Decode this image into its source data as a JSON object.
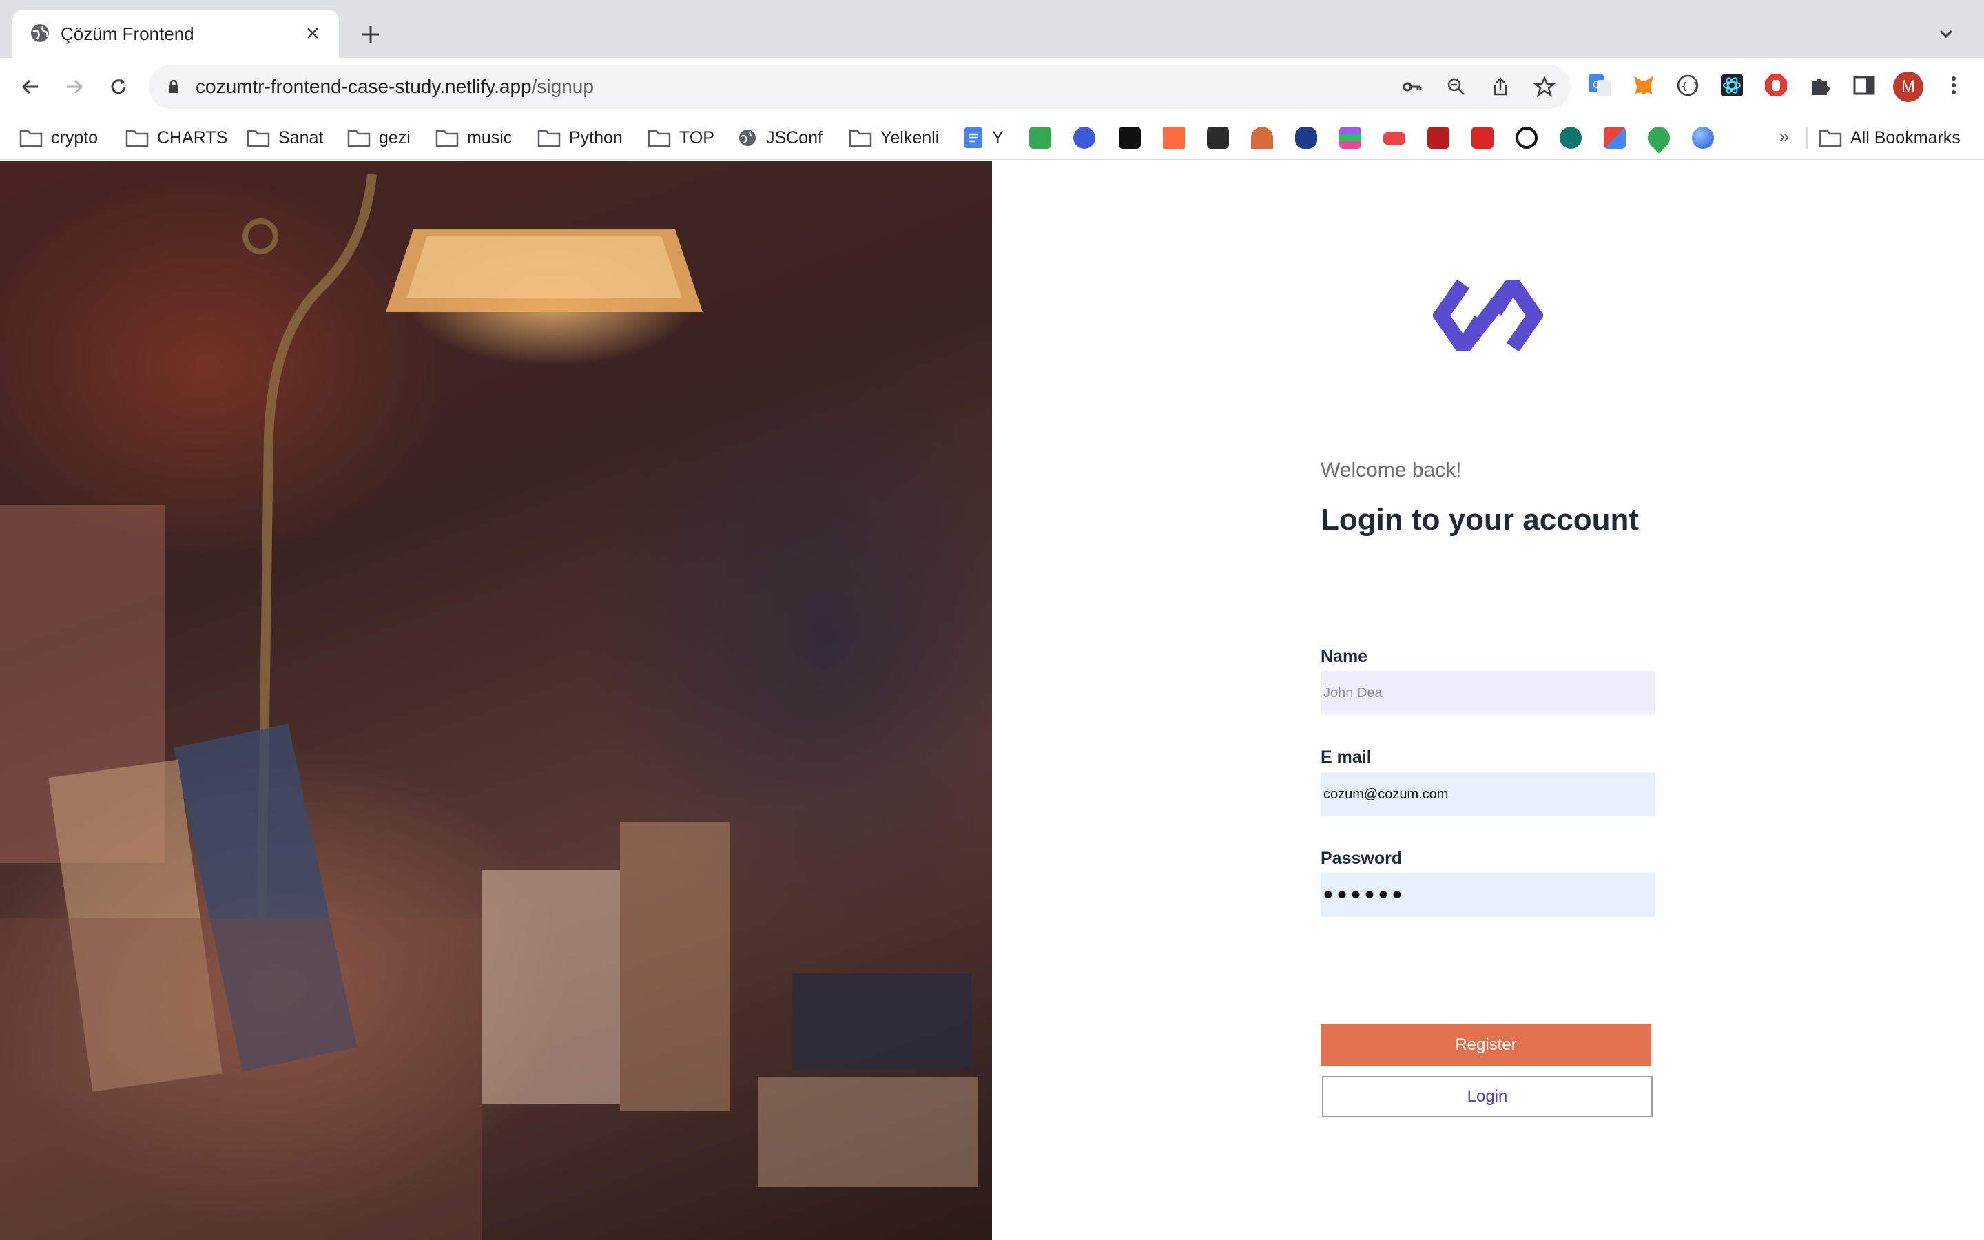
{
  "browser": {
    "tab_title": "Çözüm Frontend",
    "url_host": "cozumtr-frontend-case-study.netlify.app",
    "url_path": "/signup",
    "avatar_letter": "M",
    "bookmarks": [
      "crypto",
      "CHARTS",
      "Sanat",
      "gezi",
      "music",
      "Python",
      "TOP",
      "JSConf",
      "Yelkenli",
      "Y"
    ],
    "bookmarks_more": "»",
    "all_bookmarks": "All Bookmarks"
  },
  "login": {
    "welcome": "Welcome back!",
    "heading": "Login to your account",
    "name_label": "Name",
    "name_placeholder": "John Dea",
    "email_label": "E mail",
    "email_value": "cozum@cozum.com",
    "password_label": "Password",
    "password_value": "••••••",
    "register_label": "Register",
    "login_label": "Login"
  },
  "colors": {
    "brand_purple": "#5b4bd1",
    "register_orange": "#e2714f",
    "login_text": "#4f3fb8"
  }
}
